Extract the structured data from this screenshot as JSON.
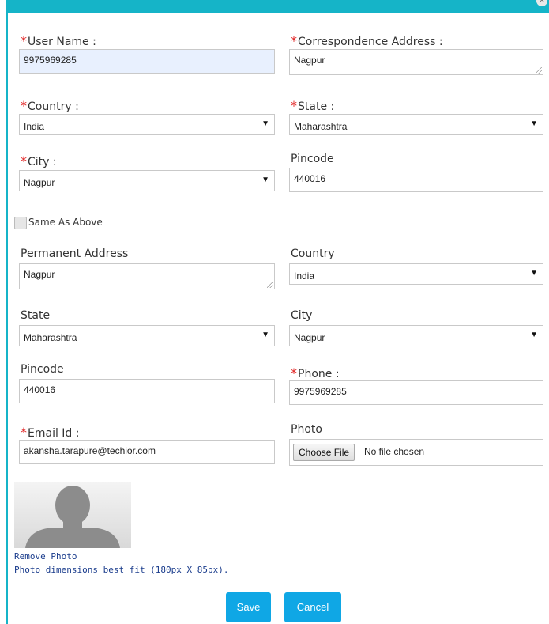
{
  "window": {
    "close_glyph": "×"
  },
  "form": {
    "user_name_label": "User Name :",
    "user_name_value": "9975969285",
    "corr_address_label": "Correspondence Address :",
    "corr_address_value": "Nagpur",
    "country_label": "Country :",
    "country_value": "India",
    "state_label": "State :",
    "state_value": "Maharashtra",
    "city_label": "City :",
    "city_value": "Nagpur",
    "pincode_label": "Pincode",
    "pincode_value": "440016",
    "same_as_above_label": "Same As Above",
    "perm_address_label": "Permanent Address",
    "perm_address_value": "Nagpur",
    "perm_country_label": "Country",
    "perm_country_value": "India",
    "perm_state_label": "State",
    "perm_state_value": "Maharashtra",
    "perm_city_label": "City",
    "perm_city_value": "Nagpur",
    "perm_pincode_label": "Pincode",
    "perm_pincode_value": "440016",
    "phone_label": "Phone :",
    "phone_value": "9975969285",
    "email_label": "Email Id :",
    "email_value": "akansha.tarapure@techior.com",
    "photo_label": "Photo",
    "choose_file_label": "Choose File",
    "no_file_text": "No file chosen",
    "remove_photo_label": "Remove Photo",
    "photo_hint": "Photo dimensions best fit (180px X 85px).",
    "save_label": "Save",
    "cancel_label": "Cancel",
    "required_mark": "*",
    "dropdown_arrow": "▼"
  },
  "colors": {
    "accent": "#15b4c8",
    "button": "#0fa7e5",
    "required": "#e02020",
    "link": "#1a3c8c"
  }
}
